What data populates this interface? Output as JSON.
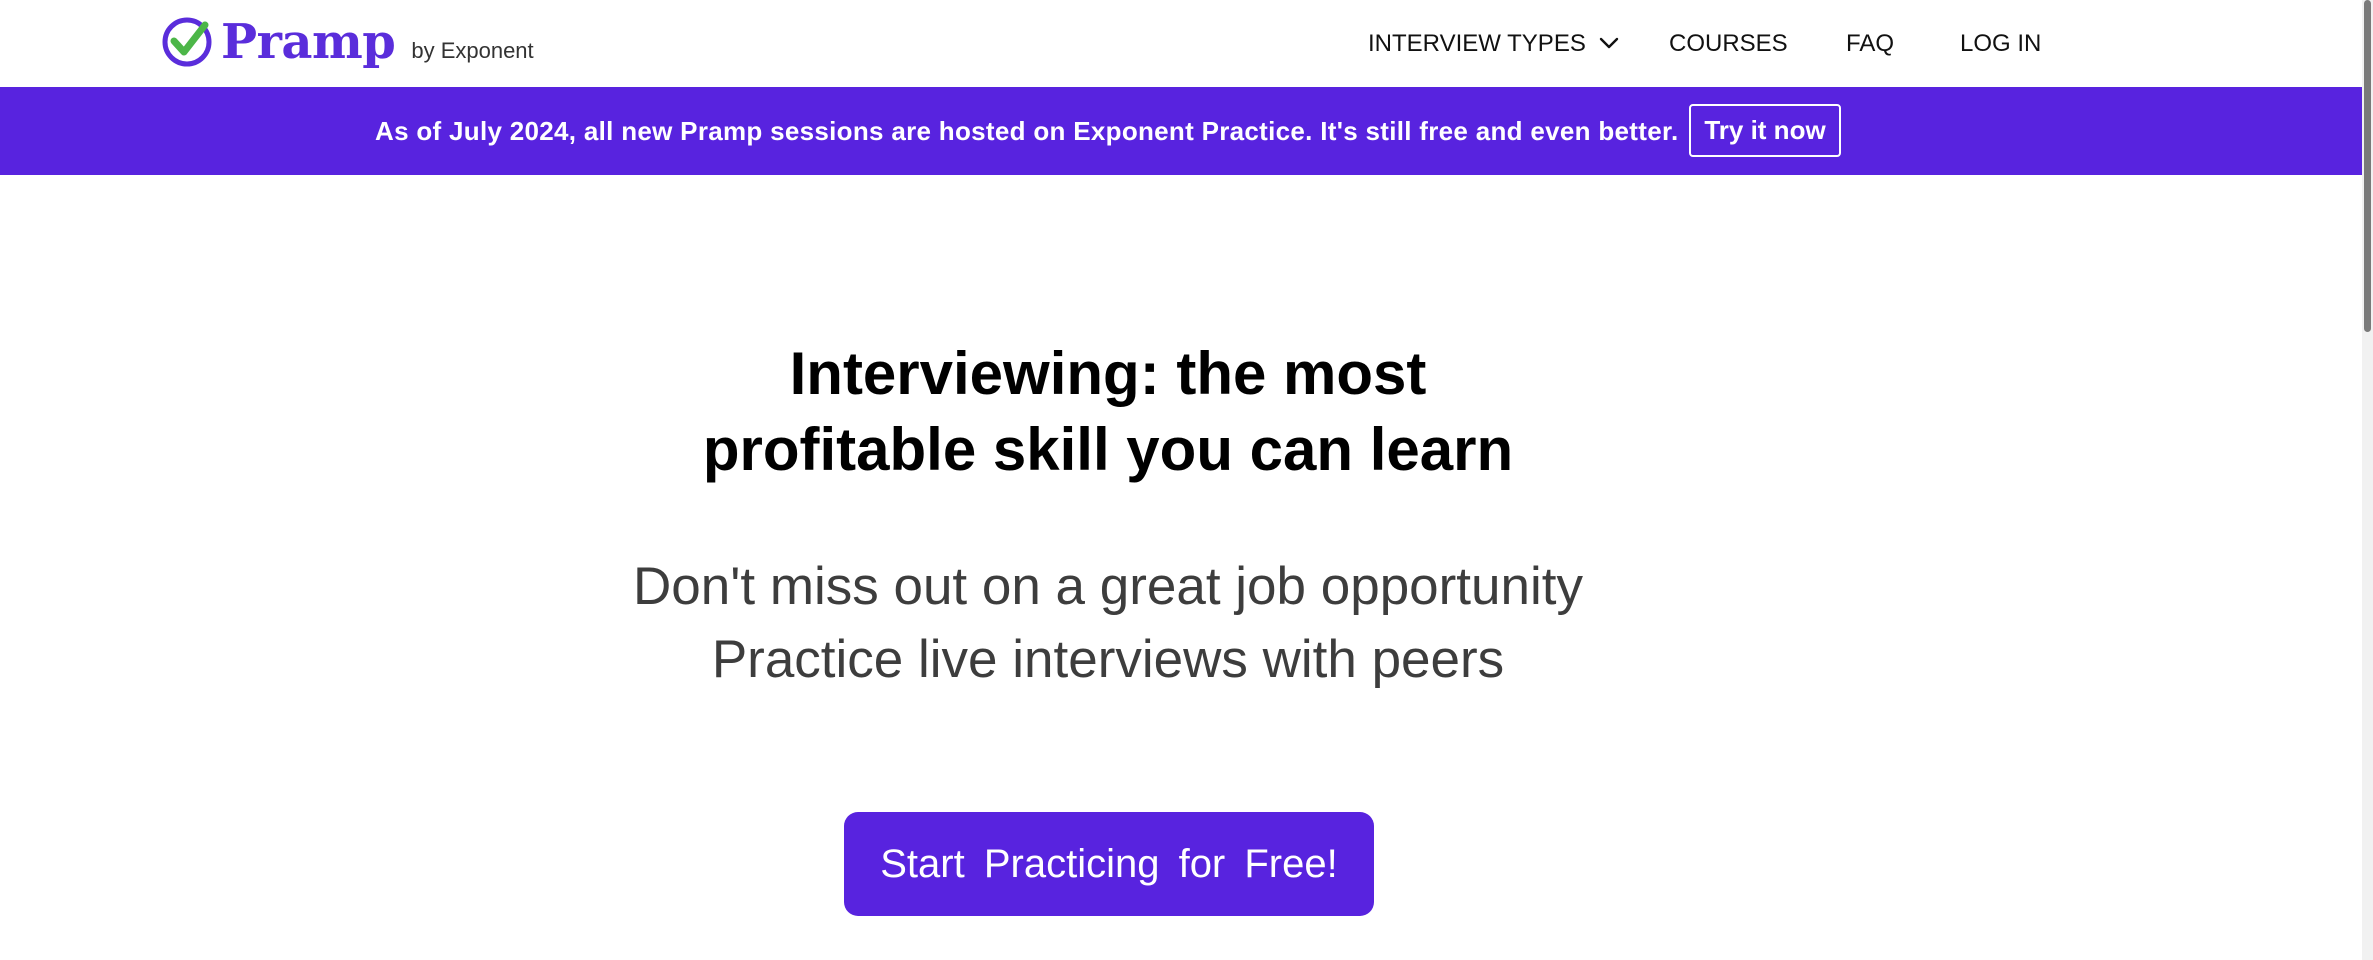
{
  "header": {
    "logo_text": "Pramp",
    "logo_byline": "by Exponent",
    "nav": {
      "interview_types": "INTERVIEW TYPES",
      "courses": "COURSES",
      "faq": "FAQ",
      "login": "LOG IN"
    }
  },
  "banner": {
    "message": "As of July 2024, all new Pramp sessions are hosted on Exponent Practice. It's still free and even better.",
    "button_label": "Try it now"
  },
  "hero": {
    "title_line1": "Interviewing: the most",
    "title_line2": "profitable skill you can learn",
    "subtitle_line1": "Don't miss out on a great job opportunity",
    "subtitle_line2": "Practice live interviews with peers",
    "cta_label": "Start Practicing for Free!"
  },
  "icons": {
    "logo": "check-circle-icon",
    "dropdown": "chevron-down-icon"
  },
  "colors": {
    "brand_purple": "#5823df",
    "logo_purple": "#5a2ddb",
    "check_green": "#4cb648",
    "text_dark": "#000000",
    "text_muted": "#3d3d3d"
  }
}
